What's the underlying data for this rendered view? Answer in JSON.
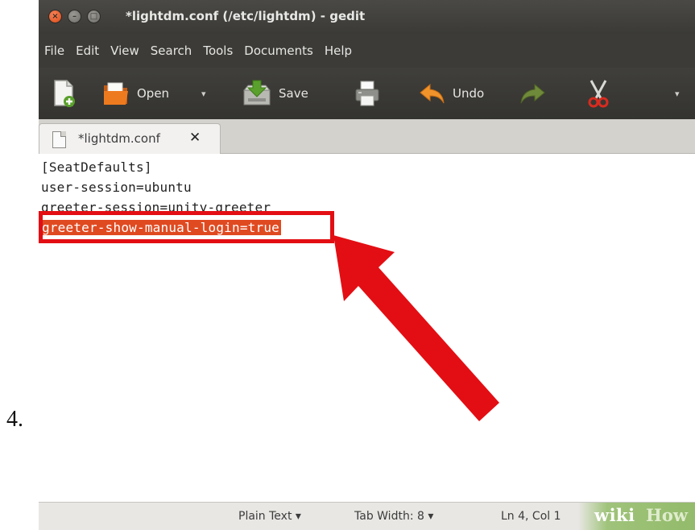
{
  "step": {
    "number": "4."
  },
  "window": {
    "title": "*lightdm.conf (/etc/lightdm) - gedit",
    "controls": {
      "close": "×",
      "minimize": "–",
      "maximize": "□"
    }
  },
  "menubar": {
    "items": [
      "File",
      "Edit",
      "View",
      "Search",
      "Tools",
      "Documents",
      "Help"
    ]
  },
  "toolbar": {
    "new_icon": "new-document-icon",
    "open_label": "Open",
    "open_arrow": "▾",
    "save_label": "Save",
    "print_icon": "printer-icon",
    "undo_label": "Undo",
    "redo_icon": "redo-icon",
    "cut_icon": "scissors-icon",
    "overflow_arrow": "▾"
  },
  "tab": {
    "label": "*lightdm.conf",
    "close": "✕"
  },
  "editor": {
    "lines": [
      "[SeatDefaults]",
      "user-session=ubuntu",
      "greeter-session=unity-greeter",
      "greeter-show-manual-login=true"
    ],
    "selected_line": 4
  },
  "statusbar": {
    "language": "Plain Text ▾",
    "tab_width": "Tab Width: 8 ▾",
    "position": "Ln 4, Col 1"
  },
  "watermark": {
    "wiki": "wiki",
    "how": "How"
  },
  "colors": {
    "title_bar": "#3c3b37",
    "close_button": "#dd4814",
    "selection": "#e04a21",
    "annotation_red": "#e30e13",
    "watermark_green": "#93bb6b"
  }
}
